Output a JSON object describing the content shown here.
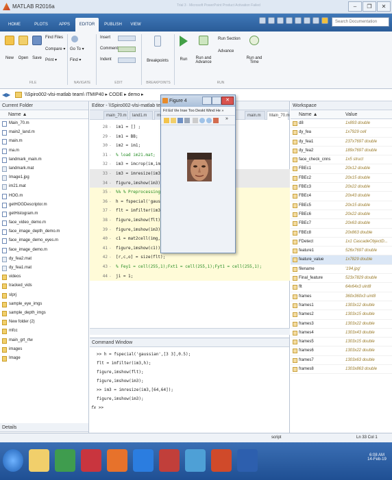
{
  "window": {
    "title": "MATLAB R2016a",
    "center_text": "Trial 3 · Microsoft PowerPoint Product Activation Failed",
    "minimize": "–",
    "restore": "❐",
    "close": "✕"
  },
  "tabs": [
    "HOME",
    "PLOTS",
    "APPS",
    "EDITOR",
    "PUBLISH",
    "VIEW"
  ],
  "active_tab": "EDITOR",
  "search_placeholder": "Search Documentation",
  "ribbon": {
    "file": {
      "new": "New",
      "open": "Open",
      "save": "Save",
      "find_files": "Find Files",
      "compare": "Compare ▾",
      "print": "Print ▾",
      "label": "FILE"
    },
    "navigate": {
      "go_to": "Go To ▾",
      "find": "Find ▾",
      "label": "NAVIGATE"
    },
    "edit": {
      "insert": "Insert",
      "comment": "Comment",
      "indent": "Indent",
      "label": "EDIT"
    },
    "breakpoints": {
      "breakpoints": "Breakpoints",
      "label": "BREAKPOINTS"
    },
    "run": {
      "run": "Run",
      "run_advance": "Run and Advance",
      "run_section": "Run Section",
      "advance": "Advance",
      "run_time": "Run and Time",
      "label": "RUN"
    }
  },
  "address": {
    "path": "\\\\Spiro002-vlsi-matlab team\\ ITMIP40 ▸ CODE ▸ demo ▸"
  },
  "current_folder": {
    "title": "Current Folder",
    "column": "Name ▲",
    "items": [
      {
        "name": "Main_70.m",
        "kind": "m"
      },
      {
        "name": "main2_land.m",
        "kind": "m"
      },
      {
        "name": "main.m",
        "kind": "m"
      },
      {
        "name": "ma.m",
        "kind": "m"
      },
      {
        "name": "landmark_main.m",
        "kind": "m"
      },
      {
        "name": "landmark.mat",
        "kind": "f"
      },
      {
        "name": "Image1.jpg",
        "kind": "f"
      },
      {
        "name": "im21.mat",
        "kind": "f"
      },
      {
        "name": "HOG.m",
        "kind": "m"
      },
      {
        "name": "getHOGDescriptor.m",
        "kind": "m"
      },
      {
        "name": "getHistogram.m",
        "kind": "m"
      },
      {
        "name": "face_video_demo.m",
        "kind": "m"
      },
      {
        "name": "face_image_depth_demo.m",
        "kind": "m"
      },
      {
        "name": "face_image_demo_eyes.m",
        "kind": "m"
      },
      {
        "name": "face_image_demo.m",
        "kind": "m"
      },
      {
        "name": "dy_fea2.mat",
        "kind": "f"
      },
      {
        "name": "dy_fea1.mat",
        "kind": "f"
      },
      {
        "name": "videos",
        "kind": "dir"
      },
      {
        "name": "tracked_vids",
        "kind": "dir"
      },
      {
        "name": "slprj",
        "kind": "dir"
      },
      {
        "name": "sample_eye_imgs",
        "kind": "dir"
      },
      {
        "name": "sample_depth_imgs",
        "kind": "dir"
      },
      {
        "name": "New folder (2)",
        "kind": "dir"
      },
      {
        "name": "mfcc",
        "kind": "dir"
      },
      {
        "name": "main_grt_rtw",
        "kind": "dir"
      },
      {
        "name": "images",
        "kind": "dir"
      },
      {
        "name": "Image",
        "kind": "dir"
      }
    ],
    "details": "Details"
  },
  "editor": {
    "title": "Editor - \\\\Spiro002-vlsi-matlab team\\ ITMIP4",
    "tabs": [
      "main_70.m",
      "land1.m",
      "ma",
      "main.m",
      "Main_70.m"
    ],
    "lines": [
      {
        "n": "28",
        "code": "im1 = [] ;",
        "bg": "n"
      },
      {
        "n": "29",
        "code": "im1 = BB;",
        "bg": "n"
      },
      {
        "n": "30",
        "code": "im2 = im1;",
        "bg": "n"
      },
      {
        "n": "31",
        "code": "% load im21.mat;",
        "bg": "c"
      },
      {
        "n": "32",
        "code": "im3 = imcrop(im,im2(1,:));",
        "bg": "n"
      },
      {
        "n": "33",
        "code": "im3 = imresize(im3,[64,64]);",
        "bg": "h"
      },
      {
        "n": "34",
        "code": "figure,imshow(im3);",
        "bg": "h"
      },
      {
        "n": "35",
        "code": "%% %  Preprocessing",
        "bg": "y"
      },
      {
        "n": "36",
        "code": "h = fspecial('gaussian',[3 3],0.5);",
        "bg": "y"
      },
      {
        "n": "37",
        "code": "flt = imfilter(im3,h);",
        "bg": "y"
      },
      {
        "n": "38",
        "code": "figure,imshow(flt);",
        "bg": "y"
      },
      {
        "n": "39",
        "code": "figure,imshow(im3);",
        "bg": "y"
      },
      {
        "n": "40",
        "code": "c1 = mat2cell(img,16*ones(8,1),16*ones(8,1));",
        "bg": "y"
      },
      {
        "n": "41",
        "code": "figure,imshow(c1))",
        "bg": "y"
      },
      {
        "n": "42",
        "code": "[r,c,o] = size(flt);",
        "bg": "y"
      },
      {
        "n": "43",
        "code": "% Fey1 = cell(255,1);Fxt1 = cell(255,1);Fyt1 = cell(255,1);",
        "bg": "y"
      },
      {
        "n": "44",
        "code": "ji = 1;",
        "bg": "y"
      }
    ]
  },
  "figure": {
    "title": "Figure 4",
    "menu": "Fil  Ed  Vie  Inse  Too  Deskt  Wind  He »",
    "tool_more": "»"
  },
  "command_window": {
    "title": "Command Window",
    "lines": [
      ">> h = fspecial('gaussian',[3 3],0.5);",
      "flt = imfilter(im3,h);",
      "figure,imshow(flt);",
      "figure,imshow(im3);",
      ">> im3 = imresize(im3,[64,64]);",
      "figure,imshow(im3);"
    ],
    "prompt": "fx >>"
  },
  "workspace": {
    "title": "Workspace",
    "columns": [
      "Name ▲",
      "Value"
    ],
    "rows": [
      {
        "name": "d8",
        "value": "1x893 double"
      },
      {
        "name": "dy_fea",
        "value": "1x7929 cell"
      },
      {
        "name": "dy_fea1",
        "value": "237x7697 double"
      },
      {
        "name": "dy_fea2",
        "value": "189x7697 double"
      },
      {
        "name": "face_check_cnns",
        "value": "1x5 struct"
      },
      {
        "name": "FBEc1",
        "value": "20x12 double"
      },
      {
        "name": "FBEc2",
        "value": "20x15 double"
      },
      {
        "name": "FBEc3",
        "value": "20x22 double"
      },
      {
        "name": "FBEc4",
        "value": "20x43 double"
      },
      {
        "name": "FBEc5",
        "value": "20x15 double"
      },
      {
        "name": "FBEc6",
        "value": "20x22 double"
      },
      {
        "name": "FBEc7",
        "value": "20x63 double"
      },
      {
        "name": "FBEc8",
        "value": "20x863 double"
      },
      {
        "name": "FDetect",
        "value": "1x1 CascadeObjectD..."
      },
      {
        "name": "feature1",
        "value": "526x7697 double"
      },
      {
        "name": "feature_value",
        "value": "1x7829 double"
      },
      {
        "name": "filename",
        "value": "'194.jpg'"
      },
      {
        "name": "Final_feature",
        "value": "523x7829 double"
      },
      {
        "name": "flt",
        "value": "64x64x3 uint8"
      },
      {
        "name": "frames",
        "value": "360x360x3 uint8"
      },
      {
        "name": "frames1",
        "value": "1303x12 double"
      },
      {
        "name": "frames2",
        "value": "1303x15 double"
      },
      {
        "name": "frames3",
        "value": "1303x22 double"
      },
      {
        "name": "frames4",
        "value": "1303x43 double"
      },
      {
        "name": "frames5",
        "value": "1303x15 double"
      },
      {
        "name": "frames6",
        "value": "1303x22 double"
      },
      {
        "name": "frames7",
        "value": "1303x63 double"
      },
      {
        "name": "frames8",
        "value": "1303x863 double"
      }
    ]
  },
  "status": {
    "mode": "script",
    "position": "Ln  33    Col  1"
  },
  "taskbar": {
    "time": "6:08 AM",
    "date": "14-Feb-19"
  }
}
